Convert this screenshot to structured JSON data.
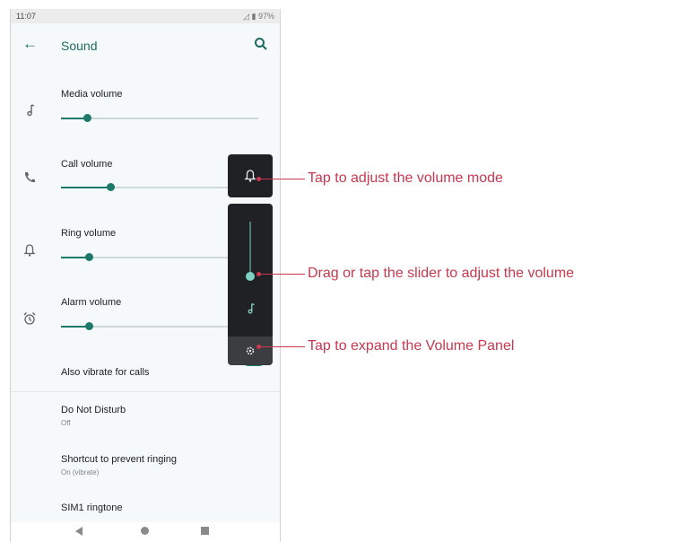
{
  "status_bar": {
    "time": "11:07",
    "battery": "97%"
  },
  "app_bar": {
    "title": "Sound",
    "back_icon": "arrow-left-icon",
    "search_icon": "search-icon"
  },
  "volume_rows": [
    {
      "label": "Media volume",
      "icon": "music-note-icon",
      "level": 0.13
    },
    {
      "label": "Call volume",
      "icon": "phone-icon",
      "level": 0.25
    },
    {
      "label": "Ring volume",
      "icon": "bell-icon",
      "level": 0.14
    },
    {
      "label": "Alarm volume",
      "icon": "alarm-clock-icon",
      "level": 0.14
    }
  ],
  "vibrate": {
    "label": "Also vibrate for calls",
    "enabled": true
  },
  "settings": [
    {
      "label": "Do Not Disturb",
      "sub": "Off"
    },
    {
      "label": "Shortcut to prevent ringing",
      "sub": "On (vibrate)"
    },
    {
      "label": "SIM1 ringtone",
      "sub": ""
    }
  ],
  "volume_panel": {
    "mode_icon": "bell-icon",
    "stream_icon": "music-note-icon",
    "settings_icon": "gear-icon",
    "level": 0.15
  },
  "callouts": [
    "Tap to adjust the volume mode",
    "Drag or tap the slider to adjust the volume",
    "Tap to expand the Volume Panel"
  ],
  "colors": {
    "accent": "#1d7a6b",
    "callout": "#c8384f",
    "panel": "#202124"
  }
}
